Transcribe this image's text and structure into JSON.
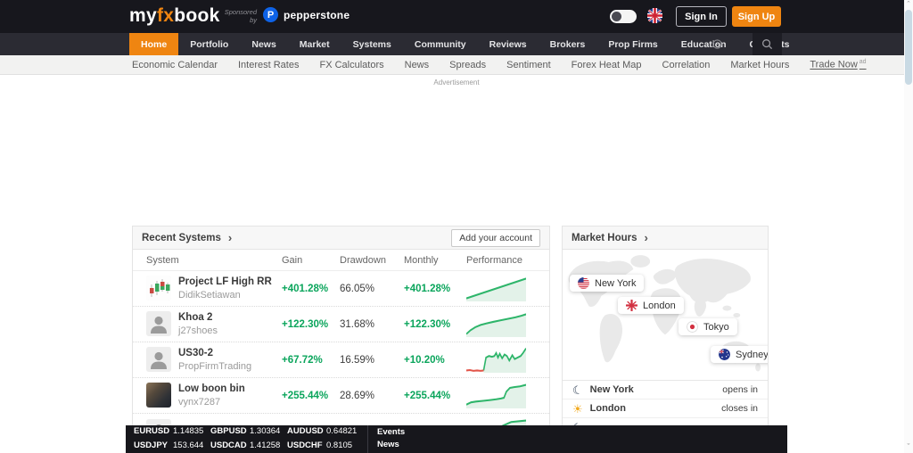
{
  "header": {
    "logo_my": "my",
    "logo_fx": "fx",
    "logo_book": "book",
    "sponsored_word1": "Sponsored",
    "sponsored_word2": "by",
    "sponsor_name": "pepperstone",
    "sponsor_initial": "P",
    "sign_in_label": "Sign In",
    "sign_up_label": "Sign Up"
  },
  "nav": {
    "items": [
      "Home",
      "Portfolio",
      "News",
      "Market",
      "Systems",
      "Community",
      "Reviews",
      "Brokers",
      "Prop Firms",
      "Education",
      "Contests"
    ],
    "active": "Home"
  },
  "subnav": {
    "items": [
      "Economic Calendar",
      "Interest Rates",
      "FX Calculators",
      "News",
      "Spreads",
      "Sentiment",
      "Forex Heat Map",
      "Correlation",
      "Market Hours"
    ],
    "trade_now": {
      "label": "Trade Now",
      "badge": "ad"
    }
  },
  "ad_label": "Advertisement",
  "recent_systems": {
    "title": "Recent Systems",
    "chevron": "›",
    "add_account_label": "Add your account",
    "columns": [
      "System",
      "Gain",
      "Drawdown",
      "Monthly",
      "Performance"
    ],
    "rows": [
      {
        "name": "Project LF High RR",
        "user": "DidikSetiawan",
        "gain": "+401.28%",
        "drawdown": "66.05%",
        "monthly": "+401.28%",
        "avatar": "candlestick-chart",
        "spark": {
          "line": "#2eb56a",
          "fill": "#e3f2e9",
          "green": [
            [
              0,
              30
            ],
            [
              100,
              4
            ]
          ]
        }
      },
      {
        "name": "Khoa 2",
        "user": "j27shoes",
        "gain": "+122.30%",
        "drawdown": "31.68%",
        "monthly": "+122.30%",
        "avatar": "person-silhouette",
        "spark": {
          "line": "#2eb56a",
          "fill": "#e3f2e9",
          "green": [
            [
              0,
              30
            ],
            [
              7,
              25
            ],
            [
              15,
              21
            ],
            [
              24,
              18
            ],
            [
              34,
              16
            ],
            [
              45,
              14
            ],
            [
              57,
              12
            ],
            [
              70,
              10
            ],
            [
              82,
              8
            ],
            [
              92,
              6
            ],
            [
              100,
              4
            ]
          ]
        }
      },
      {
        "name": "US30-2",
        "user": "PropFirmTrading",
        "gain": "+67.72%",
        "drawdown": "16.59%",
        "monthly": "+10.20%",
        "avatar": "person-silhouette",
        "spark": {
          "line": "#2eb56a",
          "fill": "#e3f2e9",
          "red_color": "#e25549",
          "red": [
            [
              0,
              31
            ],
            [
              6,
              30.5
            ],
            [
              12,
              31.5
            ],
            [
              18,
              31
            ],
            [
              24,
              31.5
            ],
            [
              29,
              31
            ]
          ],
          "green": [
            [
              29,
              31
            ],
            [
              33,
              14
            ],
            [
              38,
              12
            ],
            [
              43,
              13
            ],
            [
              47,
              12
            ],
            [
              50,
              8
            ],
            [
              53,
              14
            ],
            [
              56,
              9
            ],
            [
              60,
              15
            ],
            [
              64,
              10
            ],
            [
              68,
              12
            ],
            [
              72,
              18
            ],
            [
              77,
              11
            ],
            [
              81,
              16
            ],
            [
              86,
              14
            ],
            [
              91,
              12
            ],
            [
              95,
              8
            ],
            [
              100,
              2
            ]
          ]
        }
      },
      {
        "name": "Low boon bin",
        "user": "vynx7287",
        "gain": "+255.44%",
        "drawdown": "28.69%",
        "monthly": "+255.44%",
        "avatar": "user-photo",
        "spark": {
          "line": "#2eb56a",
          "fill": "#e3f2e9",
          "green": [
            [
              0,
              29
            ],
            [
              8,
              26
            ],
            [
              16,
              25
            ],
            [
              28,
              24
            ],
            [
              40,
              23
            ],
            [
              50,
              22
            ],
            [
              58,
              21
            ],
            [
              63,
              20
            ],
            [
              67,
              12
            ],
            [
              73,
              7
            ],
            [
              80,
              6
            ],
            [
              90,
              5
            ],
            [
              100,
              3
            ]
          ]
        }
      },
      {
        "name": "",
        "user": "",
        "gain": "",
        "drawdown": "",
        "monthly": "",
        "avatar": "person-silhouette",
        "spark": {
          "line": "#2eb56a",
          "fill": "#e3f2e9",
          "green": [
            [
              0,
              28
            ],
            [
              30,
              20
            ],
            [
              55,
              12
            ],
            [
              75,
              5
            ],
            [
              100,
              3
            ]
          ]
        }
      }
    ]
  },
  "market_hours": {
    "title": "Market Hours",
    "chevron": "›",
    "map_pins": [
      {
        "name": "New York",
        "flag": "us"
      },
      {
        "name": "London",
        "flag": "uk"
      },
      {
        "name": "Tokyo",
        "flag": "jp"
      },
      {
        "name": "Sydney",
        "flag": "au"
      }
    ],
    "sessions": [
      {
        "city": "New York",
        "icon": "moon",
        "status": "opens in"
      },
      {
        "city": "London",
        "icon": "sun",
        "status": "closes in"
      },
      {
        "city": "",
        "icon": "moon",
        "status": ""
      }
    ]
  },
  "ticker": {
    "quotes": [
      [
        {
          "symbol": "EURUSD",
          "value": "1.14835"
        },
        {
          "symbol": "GBPUSD",
          "value": "1.30364"
        },
        {
          "symbol": "AUDUSD",
          "value": "0.64821"
        }
      ],
      [
        {
          "symbol": "USDJPY",
          "value": "153.644"
        },
        {
          "symbol": "USDCAD",
          "value": "1.41258"
        },
        {
          "symbol": "USDCHF",
          "value": "0.8105"
        }
      ]
    ],
    "links": [
      "Events",
      "News"
    ]
  },
  "colors": {
    "accent_orange": "#ef8511",
    "green": "#0ba55c",
    "red": "#e25549"
  }
}
